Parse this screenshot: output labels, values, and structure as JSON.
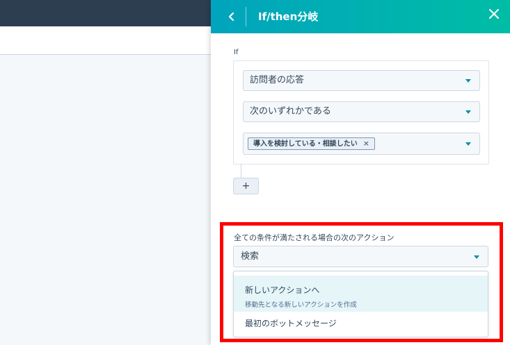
{
  "panel": {
    "title": "If/then分岐",
    "back_icon": "chevron-left-icon",
    "close_icon": "close-icon"
  },
  "condition": {
    "label": "If",
    "property_select": "訪問者の応答",
    "operator_select": "次のいずれかである",
    "values": [
      {
        "tag": "導入を検討している・相談したい",
        "remove_glyph": "×"
      }
    ],
    "add_button": "+"
  },
  "action": {
    "label": "全ての条件が満たされる場合の次のアクション",
    "search_value": "検索",
    "options": [
      {
        "title": "新しいアクションへ",
        "subtitle": "移動先となる新しいアクションを作成"
      },
      {
        "title": "最初のボットメッセージ"
      }
    ]
  },
  "colors": {
    "header_gradient_start": "#00a4bd",
    "header_gradient_end": "#00bda5",
    "highlight": "#ff0000",
    "caret": "#0091ae",
    "topbar": "#2d3e50"
  }
}
